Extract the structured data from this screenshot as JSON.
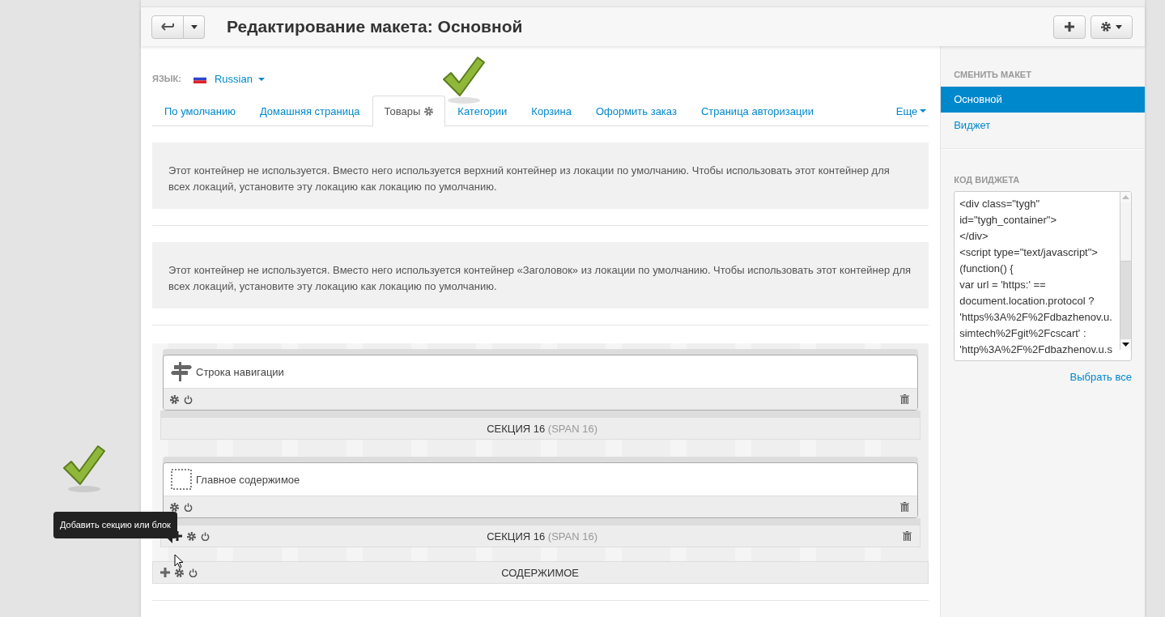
{
  "header": {
    "title": "Редактирование макета: Основной"
  },
  "language": {
    "label": "ЯЗЫК:",
    "value": "Russian"
  },
  "tabs": [
    {
      "label": "По умолчанию",
      "selected": false
    },
    {
      "label": "Домашняя страница",
      "selected": false
    },
    {
      "label": "Товары",
      "selected": true
    },
    {
      "label": "Категории",
      "selected": false
    },
    {
      "label": "Корзина",
      "selected": false
    },
    {
      "label": "Оформить заказ",
      "selected": false
    },
    {
      "label": "Страница авторизации",
      "selected": false
    }
  ],
  "more_tab": "Еще",
  "notices": [
    "Этот контейнер не используется. Вместо него используется верхний контейнер из локации по умолчанию. Чтобы использовать этот контейнер для всех локаций, установите эту локацию как локацию по умолчанию.",
    "Этот контейнер не используется. Вместо него используется контейнер «Заголовок» из локации по умолчанию. Чтобы использовать этот контейнер для всех локаций, установите эту локацию как локацию по умолчанию."
  ],
  "sections": [
    {
      "block": {
        "kind": "breadcrumbs",
        "title": "Строка навигации"
      },
      "label": "СЕКЦИЯ 16",
      "span": "(SPAN 16)",
      "hovered": false
    },
    {
      "block": {
        "kind": "main_content",
        "title": "Главное содержимое"
      },
      "label": "СЕКЦИЯ 16",
      "span": "(SPAN 16)",
      "hovered": true
    }
  ],
  "container_label": "СОДЕРЖИМОЕ",
  "tooltip": "Добавить секцию или блок",
  "sidebar": {
    "layouts_heading": "СМЕНИТЬ МАКЕТ",
    "layouts": [
      {
        "label": "Основной",
        "selected": true
      },
      {
        "label": "Виджет",
        "selected": false
      }
    ],
    "code_heading": "КОД ВИДЖЕТА",
    "code_lines": [
      "<div class=\"tygh\"",
      "id=\"tygh_container\">",
      "</div>",
      "<script type=\"text/javascript\">",
      "(function() {",
      "var url = 'https:' ==",
      "document.location.protocol ?",
      "'https%3A%2F%2Fdbazhenov.u.",
      "simtech%2Fgit%2Fcscart' :",
      "'http%3A%2F%2Fdbazhenov.u.s"
    ],
    "select_all": "Выбрать все"
  }
}
